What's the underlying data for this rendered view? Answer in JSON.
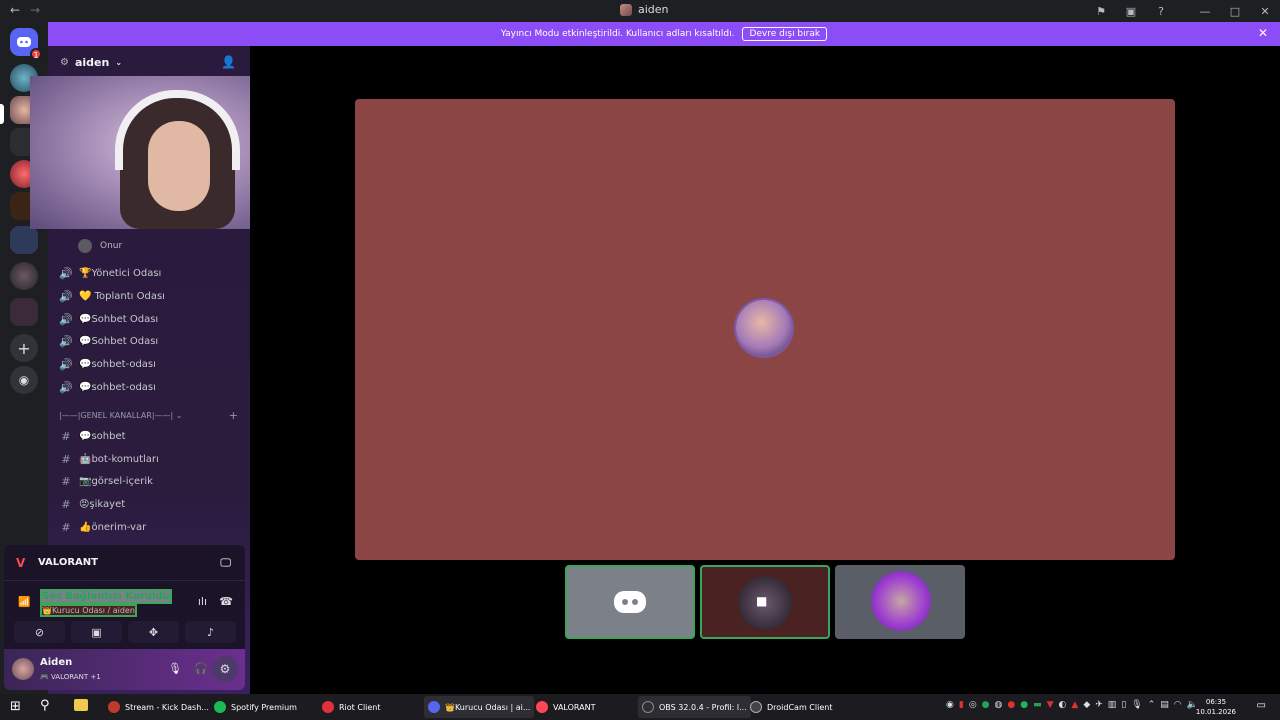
{
  "titlebar": {
    "title": "aiden",
    "back": "←",
    "forward": "→"
  },
  "banner": {
    "text": "Yayıncı Modu etkinleştirildi. Kullanıcı adları kısaltıldı.",
    "button": "Devre dışı bırak"
  },
  "server": {
    "name": "aiden",
    "badge_count": "1"
  },
  "voice_member": "Onur",
  "channels": [
    {
      "type": "voice",
      "label": "🏆Yönetici Odası"
    },
    {
      "type": "voice",
      "label": "💛 Toplantı Odası"
    },
    {
      "type": "voice",
      "label": "💬Sohbet Odası"
    },
    {
      "type": "voice",
      "label": "💬Sohbet Odası"
    },
    {
      "type": "voice",
      "label": "💬sohbet-odası"
    },
    {
      "type": "voice",
      "label": "💬sohbet-odası"
    }
  ],
  "category": "|——|GENEL KANALLAR|——|",
  "text_channels": [
    {
      "label": "💬sohbet"
    },
    {
      "label": "🤖bot-komutları"
    },
    {
      "label": "📷görsel-içerik"
    },
    {
      "label": "😡şikayet"
    },
    {
      "label": "👍önerim-var"
    }
  ],
  "activity": {
    "game": "VALORANT"
  },
  "voice_status": {
    "title": "Ses Bağlantısı Kuruldu",
    "subtitle": "👑Kurucu Odası / aiden"
  },
  "user": {
    "name": "Aiden",
    "status": "🎮 VALORANT +1"
  },
  "taskbar": {
    "apps": [
      {
        "label": "Stream - Kick Dash...",
        "color": "#c0392b"
      },
      {
        "label": "Spotify Premium",
        "color": "#1db954"
      },
      {
        "label": "Riot Client",
        "color": "#e0303b"
      },
      {
        "label": "👑Kurucu Odası | ai...",
        "color": "#5865f2"
      },
      {
        "label": "VALORANT",
        "color": "#ff4655"
      },
      {
        "label": "OBS 32.0.4 - Profil: l...",
        "color": "#302e31"
      },
      {
        "label": "DroidCam Client",
        "color": "#444"
      }
    ],
    "time": "06:35",
    "date": "10.01.2026"
  }
}
